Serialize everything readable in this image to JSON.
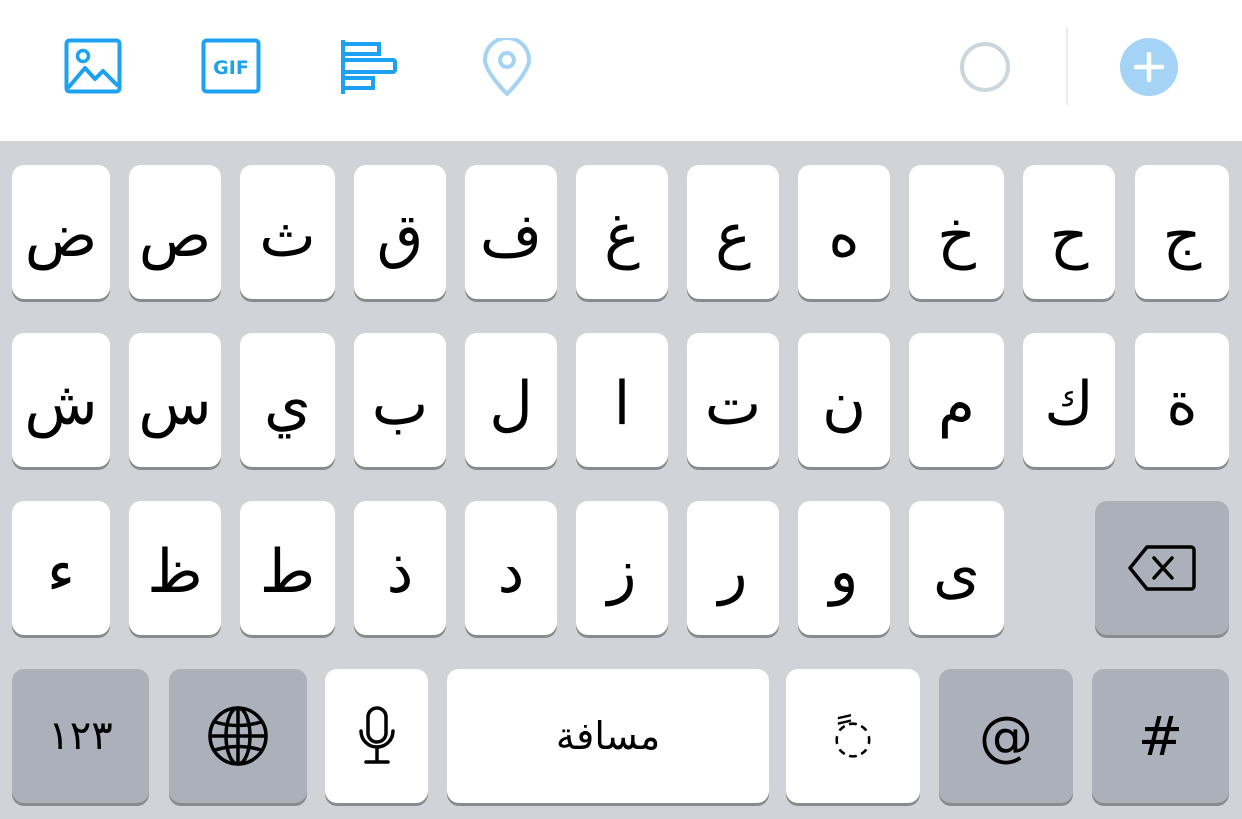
{
  "toolbar": {
    "icons": [
      "image-icon",
      "gif-icon",
      "poll-icon",
      "location-icon",
      "progress-ring-icon",
      "add-icon"
    ],
    "gif_label": "GIF",
    "colors": {
      "accent": "#1da1f2",
      "accent_light": "#a5d3f6",
      "ring": "#ccd6dd"
    }
  },
  "keyboard": {
    "row1": [
      "ض",
      "ص",
      "ث",
      "ق",
      "ف",
      "غ",
      "ع",
      "ه",
      "خ",
      "ح",
      "ج"
    ],
    "row2": [
      "ش",
      "س",
      "ي",
      "ب",
      "ل",
      "ا",
      "ت",
      "ن",
      "م",
      "ك",
      "ة"
    ],
    "row3": [
      "ء",
      "ظ",
      "ط",
      "ذ",
      "د",
      "ز",
      "ر",
      "و",
      "ى"
    ],
    "numbers_label": "١٢٣",
    "space_label": "مسافة",
    "tanween_label": "◌ً",
    "at_label": "@",
    "hash_label": "#",
    "icons": [
      "delete-icon",
      "globe-icon",
      "microphone-icon"
    ]
  }
}
